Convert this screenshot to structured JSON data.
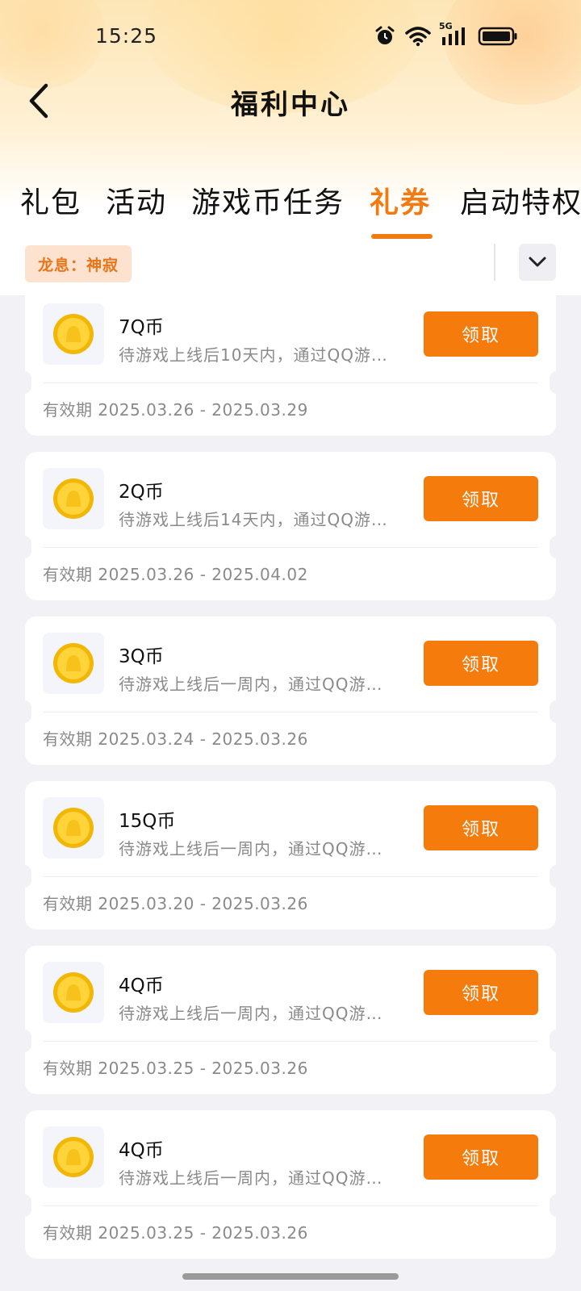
{
  "status_bar": {
    "time": "15:25",
    "network": "5G"
  },
  "header": {
    "title": "福利中心"
  },
  "tabs": [
    {
      "label": "礼包",
      "active": false
    },
    {
      "label": "活动",
      "active": false
    },
    {
      "label": "游戏币任务",
      "active": false
    },
    {
      "label": "礼券",
      "active": true
    },
    {
      "label": "启动特权",
      "active": false
    }
  ],
  "filter": {
    "tag": "龙息：神寂"
  },
  "coupons": [
    {
      "title": "7Q币",
      "desc": "待游戏上线后10天内，通过QQ游…",
      "validity": "有效期 2025.03.26 - 2025.03.29",
      "button": "领取"
    },
    {
      "title": "2Q币",
      "desc": "待游戏上线后14天内，通过QQ游…",
      "validity": "有效期 2025.03.26 - 2025.04.02",
      "button": "领取"
    },
    {
      "title": "3Q币",
      "desc": "待游戏上线后一周内，通过QQ游…",
      "validity": "有效期 2025.03.24 - 2025.03.26",
      "button": "领取"
    },
    {
      "title": "15Q币",
      "desc": "待游戏上线后一周内，通过QQ游…",
      "validity": "有效期 2025.03.20 - 2025.03.26",
      "button": "领取"
    },
    {
      "title": "4Q币",
      "desc": "待游戏上线后一周内，通过QQ游…",
      "validity": "有效期 2025.03.25 - 2025.03.26",
      "button": "领取"
    },
    {
      "title": "4Q币",
      "desc": "待游戏上线后一周内，通过QQ游…",
      "validity": "有效期 2025.03.25 - 2025.03.26",
      "button": "领取"
    }
  ],
  "colors": {
    "accent": "#f57b0c",
    "tag_bg": "#fde3cf",
    "page_bg": "#f2f2f6"
  }
}
